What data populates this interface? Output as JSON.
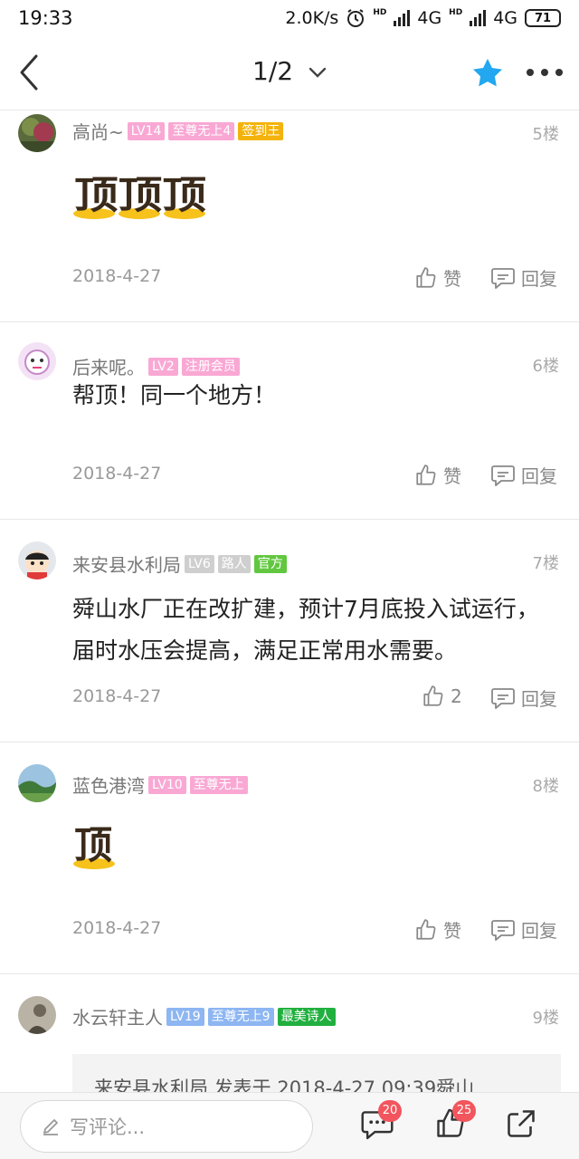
{
  "status": {
    "time": "19:33",
    "speed": "2.0K/s",
    "net1": "4G",
    "net2": "4G",
    "hd": "HD",
    "battery": "71"
  },
  "nav": {
    "page": "1/2"
  },
  "colors": {
    "tag_pink": "#f9a8d4",
    "tag_yellow": "#f4b30c",
    "tag_green_official": "#62c740",
    "tag_gray": "#cfcfcf",
    "tag_blue": "#8db6f2",
    "tag_green": "#21b03f",
    "star": "#22a7f0",
    "badge": "#f2555d"
  },
  "posts": [
    {
      "username": "高尚~",
      "level": "LV14",
      "tags": [
        "至尊无上4",
        "签到王"
      ],
      "floor": "5楼",
      "ding_text": "顶顶顶",
      "date": "2018-4-27",
      "like_label": "赞",
      "reply_label": "回复"
    },
    {
      "username": "后来呢。",
      "level": "LV2",
      "tags": [
        "注册会员"
      ],
      "floor": "6楼",
      "text": "帮顶！同一个地方！",
      "date": "2018-4-27",
      "like_label": "赞",
      "reply_label": "回复"
    },
    {
      "username": "来安县水利局",
      "level": "LV6",
      "tags": [
        "路人",
        "官方"
      ],
      "floor": "7楼",
      "text": "舜山水厂正在改扩建，预计7月底投入试运行，届时水压会提高，满足正常用水需要。",
      "date": "2018-4-27",
      "like_label": "2",
      "reply_label": "回复"
    },
    {
      "username": "蓝色港湾",
      "level": "LV10",
      "tags": [
        "至尊无上"
      ],
      "floor": "8楼",
      "ding_text": "顶",
      "date": "2018-4-27",
      "like_label": "赞",
      "reply_label": "回复"
    },
    {
      "username": "水云轩主人",
      "level": "LV19",
      "tags": [
        "至尊无上9",
        "最美诗人"
      ],
      "floor": "9楼",
      "quote": "来安县水利局 发表于 2018-4-27 09:39舜山"
    }
  ],
  "bottom": {
    "placeholder": "写评论...",
    "comment_count": "20",
    "like_count": "25"
  }
}
